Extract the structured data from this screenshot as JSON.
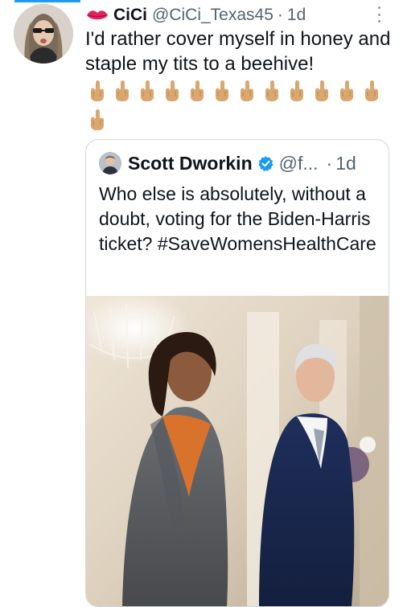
{
  "tweet": {
    "display_name": "CiCi",
    "handle": "@CiCi_Texas45",
    "separator": "·",
    "time": "1d",
    "text": "I'd rather cover myself in honey and staple my tits to a beehive!",
    "emoji": "middle-finger-emoji",
    "emoji_count": 13,
    "name_emoji": "lips-icon"
  },
  "quote": {
    "display_name": "Scott Dworkin",
    "handle": "@f...",
    "separator": "·",
    "time": "1d",
    "verified_color": "#1d9bf0",
    "text": "Who else is absolutely, without a doubt, voting for the Biden-Harris ticket? #SaveWomensHealthCare",
    "media": "photo-two-people-walking-in-white-house-hall"
  },
  "colors": {
    "accent": "#1d9bf0",
    "secondary_text": "#536471",
    "border": "#cfd9de"
  }
}
